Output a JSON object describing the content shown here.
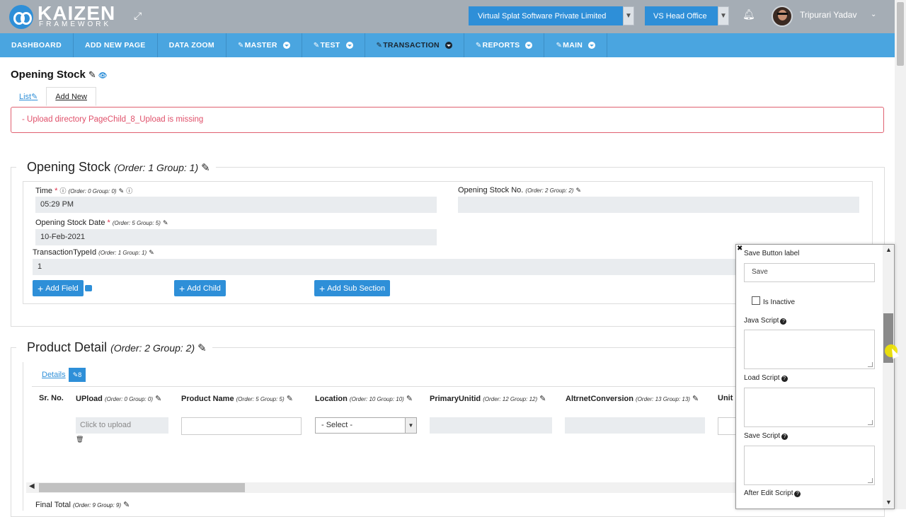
{
  "header": {
    "logo_title": "KAIZEN",
    "logo_subtitle": "FRAMEWORK",
    "company": "Virtual Splat Software Private Limited",
    "branch": "VS Head Office",
    "user_name": "Tripurari Yadav"
  },
  "nav": {
    "items": [
      {
        "label": "DASHBOARD",
        "dropdown": false
      },
      {
        "label": "ADD NEW PAGE",
        "dropdown": false
      },
      {
        "label": "DATA ZOOM",
        "dropdown": false
      },
      {
        "label": "MASTER",
        "dropdown": true
      },
      {
        "label": "TEST",
        "dropdown": true
      },
      {
        "label": "TRANSACTION",
        "dropdown": true,
        "active": true
      },
      {
        "label": "REPORTS",
        "dropdown": true
      },
      {
        "label": "MAIN",
        "dropdown": true
      }
    ]
  },
  "page": {
    "title": "Opening Stock",
    "tabs": {
      "list": "List",
      "add_new": "Add New"
    },
    "alert": "- Upload directory PageChild_8_Upload is missing"
  },
  "section1": {
    "title": "Opening Stock",
    "meta": "(Order: 1 Group: 1)",
    "fields": {
      "time": {
        "label": "Time",
        "meta": "(Order: 0 Group: 0)",
        "value": "05:29 PM"
      },
      "opening_stock_no": {
        "label": "Opening Stock No.",
        "meta": "(Order: 2 Group: 2)",
        "value": ""
      },
      "opening_stock_date": {
        "label": "Opening Stock Date",
        "meta": "(Order: 5 Group: 5)",
        "value": "10-Feb-2021"
      },
      "transaction_type_id": {
        "label": "TransactionTypeId",
        "meta": "(Order: 1 Group: 1)",
        "value": "1"
      }
    },
    "buttons": {
      "add_field": "Add Field",
      "add_child": "Add Child",
      "add_sub_section": "Add Sub Section"
    }
  },
  "section2": {
    "title": "Product Detail",
    "meta": "(Order: 2 Group: 2)",
    "details_tab": "Details",
    "details_badge": "8",
    "columns": [
      {
        "label": "Sr. No.",
        "meta": ""
      },
      {
        "label": "UPload",
        "meta": "(Order: 0 Group: 0)"
      },
      {
        "label": "Product Name",
        "meta": "(Order: 5 Group: 5)"
      },
      {
        "label": "Location",
        "meta": "(Order: 10 Group: 10)"
      },
      {
        "label": "PrimaryUnitid",
        "meta": "(Order: 12 Group: 12)"
      },
      {
        "label": "AltrnetConversion",
        "meta": "(Order: 13 Group: 13)"
      },
      {
        "label": "Unit",
        "meta": ""
      }
    ],
    "upload_placeholder": "Click to upload",
    "location_select": "- Select -",
    "final_total": {
      "label": "Final Total",
      "meta": "(Order: 9 Group: 9)"
    }
  },
  "panel": {
    "save_button_label": "Save Button label",
    "save_value": "Save",
    "is_inactive": "Is Inactive",
    "java_script": "Java Script",
    "load_script": "Load Script",
    "save_script": "Save Script",
    "after_edit_script": "After Edit Script"
  },
  "colors": {
    "primary": "#2e8fd8",
    "nav": "#4aa5e0",
    "header": "#a5adb5",
    "alert": "#e0506a"
  }
}
